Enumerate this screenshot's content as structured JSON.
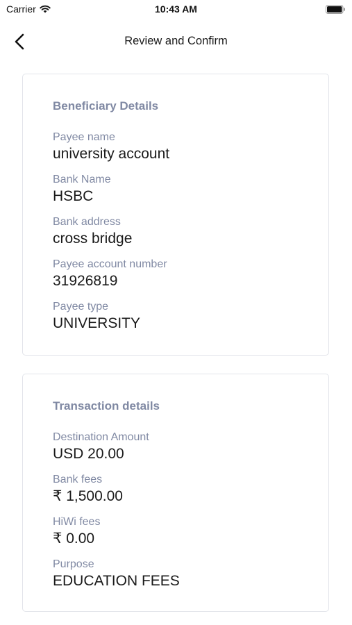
{
  "status_bar": {
    "carrier": "Carrier",
    "time": "10:43 AM",
    "wifi_icon": "wifi-icon",
    "battery_icon": "battery-icon"
  },
  "nav": {
    "back_icon": "chevron-left-icon",
    "title": "Review and Confirm"
  },
  "beneficiary": {
    "title": "Beneficiary Details",
    "fields": [
      {
        "label": "Payee name",
        "value": "university account"
      },
      {
        "label": "Bank Name",
        "value": "HSBC"
      },
      {
        "label": "Bank address",
        "value": "cross bridge"
      },
      {
        "label": "Payee account number",
        "value": "31926819"
      },
      {
        "label": "Payee type",
        "value": "UNIVERSITY"
      }
    ]
  },
  "transaction": {
    "title": "Transaction details",
    "fields": [
      {
        "label": "Destination Amount",
        "value": "USD 20.00"
      },
      {
        "label": "Bank fees",
        "value": "₹ 1,500.00"
      },
      {
        "label": "HiWi fees",
        "value": "₹ 0.00"
      },
      {
        "label": "Purpose",
        "value": "EDUCATION FEES"
      }
    ]
  },
  "colors": {
    "label": "#8089a3",
    "value": "#1a1a1a",
    "card_border": "#e2e4ea"
  }
}
